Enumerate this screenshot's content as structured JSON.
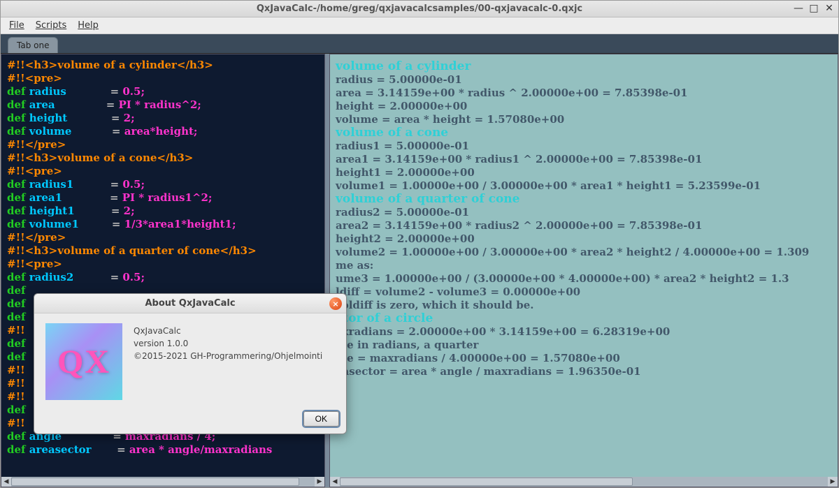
{
  "window": {
    "title": "QxJavaCalc-/home/greg/qxjavacalcsamples/00-qxjavacalc-0.qxjc",
    "min_glyph": "—",
    "max_glyph": "□",
    "close_glyph": "✕"
  },
  "menubar": {
    "file": "File",
    "scripts": "Scripts",
    "help": "Help"
  },
  "tabs": {
    "tab1": "Tab one"
  },
  "code": {
    "l01_c": "#!!<h3>volume of a cylinder</h3>",
    "l02_c": "#!!<pre>",
    "l03_d": "def ",
    "l03_n": "radius",
    "l03_pad": "            ",
    "l03_e": "= ",
    "l03_v": "0.5;",
    "l04_d": "def ",
    "l04_n": "area",
    "l04_pad": "              ",
    "l04_e": "= ",
    "l04_v": "PI * radius^2;",
    "l05_d": "def ",
    "l05_n": "height",
    "l05_pad": "            ",
    "l05_e": "= ",
    "l05_v": "2;",
    "l06_d": "def ",
    "l06_n": "volume",
    "l06_pad": "           ",
    "l06_e": "= ",
    "l06_v": "area*height;",
    "l07_c": "#!!</pre>",
    "l08_c": "#!!<h3>volume of a cone</h3>",
    "l09_c": "#!!<pre>",
    "l10_d": "def ",
    "l10_n": "radius1",
    "l10_pad": "          ",
    "l10_e": "= ",
    "l10_v": "0.5;",
    "l11_d": "def ",
    "l11_n": "area1",
    "l11_pad": "             ",
    "l11_e": "= ",
    "l11_v": "PI * radius1^2;",
    "l12_d": "def ",
    "l12_n": "height1",
    "l12_pad": "          ",
    "l12_e": "= ",
    "l12_v": "2;",
    "l13_d": "def ",
    "l13_n": "volume1",
    "l13_pad": "         ",
    "l13_e": "= ",
    "l13_v": "1/3*area1*height1;",
    "l14_c": "#!!</pre>",
    "l15_c": "#!!<h3>volume of a quarter of cone</h3>",
    "l16_c": "#!!<pre>",
    "l17_d": "def ",
    "l17_n": "radius2",
    "l17_pad": "          ",
    "l17_e": "= ",
    "l17_v": "0.5;",
    "l18_d": "def ",
    "l19_d": "def ",
    "l20_d": "def ",
    "l21_c": "#!!",
    "l22_d": "def ",
    "l23_d": "def ",
    "l24_c": "#!!",
    "l25_c": "#!!",
    "l26_c": "#!!",
    "l27_d": "def ",
    "l28_c": "#!!",
    "l29_d": "def ",
    "l29_n": "angle",
    "l29_pad": "              ",
    "l29_e": "= ",
    "l29_v": "maxradians / 4;",
    "l30_d": "def ",
    "l30_n": "areasector",
    "l30_pad": "       ",
    "l30_e": "= ",
    "l30_v": "area * angle/maxradians"
  },
  "output": {
    "h1": "volume of a cylinder",
    "o1": "radius = 5.00000e-01",
    "o2": "area = 3.14159e+00 * radius ^ 2.00000e+00 = 7.85398e-01",
    "o3": "height = 2.00000e+00",
    "o4": "volume = area * height = 1.57080e+00",
    "h2": "volume of a cone",
    "o5": "radius1 = 5.00000e-01",
    "o6": "area1 = 3.14159e+00 * radius1 ^ 2.00000e+00 = 7.85398e-01",
    "o7": "height1 = 2.00000e+00",
    "o8": "volume1 = 1.00000e+00 / 3.00000e+00 * area1 * height1 = 5.23599e-01",
    "h3": "volume of a quarter of cone",
    "o9": "radius2 = 5.00000e-01",
    "o10": "area2 = 3.14159e+00 * radius2 ^ 2.00000e+00 = 7.85398e-01",
    "o11": "height2 = 2.00000e+00",
    "o12": "volume2 = 1.00000e+00 / 3.00000e+00 * area2 * height2 / 4.00000e+00 = 1.309",
    "o13": "me as:",
    "o14": "ume3 = 1.00000e+00 / (3.00000e+00 * 4.00000e+00) * area2 * height2 = 1.3",
    "o15": "ldiff = volume2 - volume3 = 0.00000e+00",
    "o16": "voldiff is zero, which it should be.",
    "h4": "ctor of a circle",
    "o17": "axradians = 2.00000e+00 * 3.14159e+00 = 6.28319e+00",
    "o18": "gle in radians, a quarter",
    "o19": "gle = maxradians / 4.00000e+00 = 1.57080e+00",
    "o20": "easector = area * angle / maxradians = 1.96350e-01"
  },
  "dialog": {
    "title": "About QxJavaCalc",
    "logo_text": "QX",
    "name": "QxJavaCalc",
    "version": "version 1.0.0",
    "copyright": "©2015-2021 GH-Programmering/Ohjelmointi",
    "ok": "OK",
    "close_glyph": "×"
  }
}
